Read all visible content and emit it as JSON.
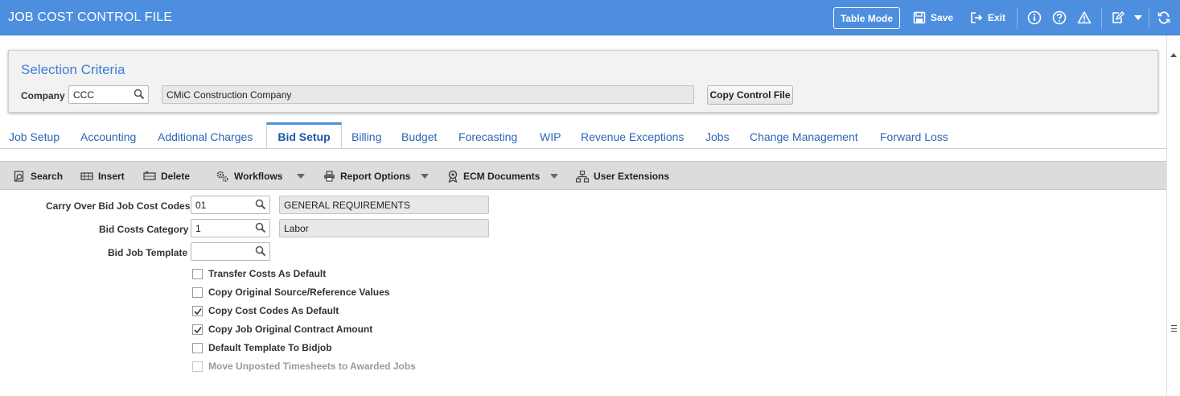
{
  "header": {
    "title": "JOB COST CONTROL FILE",
    "table_mode_label": "Table Mode",
    "save_label": "Save",
    "exit_label": "Exit",
    "icons": [
      "info-icon",
      "help-icon",
      "warning-icon",
      "edit-notes-icon",
      "dropdown-icon",
      "refresh-icon"
    ]
  },
  "selection": {
    "title": "Selection Criteria",
    "company_label": "Company",
    "company_value": "CCC",
    "company_name": "CMiC Construction Company",
    "copy_button": "Copy Control File"
  },
  "tabs": [
    {
      "label": "Job Setup"
    },
    {
      "label": "Accounting"
    },
    {
      "label": "Additional Charges"
    },
    {
      "label": "Bid Setup",
      "active": true
    },
    {
      "label": "Billing"
    },
    {
      "label": "Budget"
    },
    {
      "label": "Forecasting"
    },
    {
      "label": "WIP"
    },
    {
      "label": "Revenue Exceptions"
    },
    {
      "label": "Jobs"
    },
    {
      "label": "Change Management"
    },
    {
      "label": "Forward Loss"
    }
  ],
  "toolbar": {
    "search": "Search",
    "insert": "Insert",
    "delete": "Delete",
    "workflows": "Workflows",
    "report_options": "Report Options",
    "ecm_documents": "ECM Documents",
    "user_extensions": "User Extensions"
  },
  "form": {
    "carry_over_label": "Carry Over Bid Job Cost Codes",
    "carry_over_value": "01",
    "carry_over_desc": "GENERAL REQUIREMENTS",
    "category_label": "Bid Costs Category",
    "category_value": "1",
    "category_desc": "Labor",
    "template_label": "Bid Job Template",
    "template_value": "",
    "checkboxes": [
      {
        "label": "Transfer Costs As Default",
        "checked": false,
        "disabled": false
      },
      {
        "label": "Copy Original Source/Reference Values",
        "checked": false,
        "disabled": false
      },
      {
        "label": "Copy Cost Codes As Default",
        "checked": true,
        "disabled": false
      },
      {
        "label": "Copy Job Original Contract Amount",
        "checked": true,
        "disabled": false
      },
      {
        "label": "Default Template To Bidjob",
        "checked": false,
        "disabled": false
      },
      {
        "label": "Move Unposted Timesheets to Awarded Jobs",
        "checked": false,
        "disabled": true
      }
    ]
  }
}
